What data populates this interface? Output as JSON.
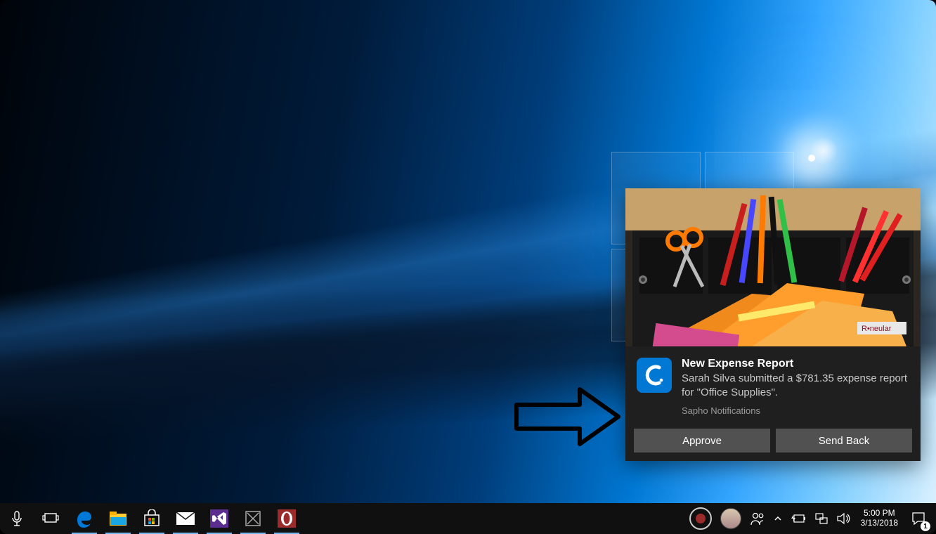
{
  "notification": {
    "title": "New Expense Report",
    "message": "Sarah Silva submitted a $781.35 expense report for \"Office Supplies\".",
    "attribution": "Sapho Notifications",
    "app_icon_letter": "C",
    "actions": {
      "approve": "Approve",
      "send_back": "Send Back"
    }
  },
  "taskbar": {
    "items": [
      {
        "name": "cortana-mic",
        "icon": "mic"
      },
      {
        "name": "task-view",
        "icon": "taskview"
      },
      {
        "name": "edge",
        "icon": "edge",
        "running": true
      },
      {
        "name": "file-explorer",
        "icon": "explorer",
        "running": true
      },
      {
        "name": "microsoft-store",
        "icon": "store",
        "running": true
      },
      {
        "name": "mail",
        "icon": "mail",
        "running": true
      },
      {
        "name": "visual-studio",
        "icon": "vs",
        "running": true
      },
      {
        "name": "unknown-app",
        "icon": "boxx",
        "running": true
      },
      {
        "name": "opera",
        "icon": "opera",
        "running": true
      }
    ]
  },
  "systray": {
    "time": "5:00 PM",
    "date": "3/13/2018",
    "action_center_count": "1"
  }
}
